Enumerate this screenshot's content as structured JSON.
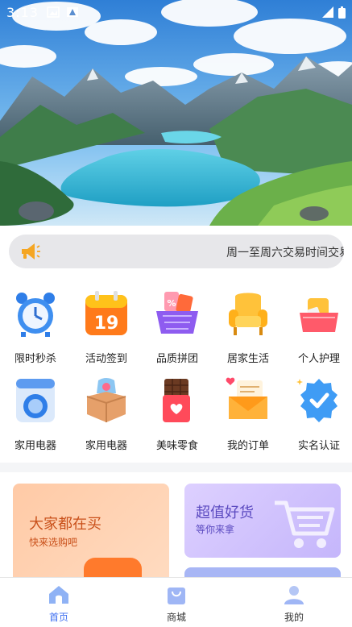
{
  "status_bar": {
    "time": "3:13"
  },
  "notice": {
    "text": "周一至周六交易时间交易"
  },
  "grid": {
    "items": [
      {
        "label": "限时秒杀",
        "icon": "alarm-clock-icon"
      },
      {
        "label": "活动签到",
        "icon": "calendar-19-icon"
      },
      {
        "label": "品质拼团",
        "icon": "shopping-basket-icon"
      },
      {
        "label": "居家生活",
        "icon": "armchair-icon"
      },
      {
        "label": "个人护理",
        "icon": "gift-basket-icon"
      },
      {
        "label": "家用电器",
        "icon": "washing-machine-icon"
      },
      {
        "label": "家用电器",
        "icon": "open-box-icon"
      },
      {
        "label": "美味零食",
        "icon": "chocolate-icon"
      },
      {
        "label": "我的订单",
        "icon": "order-envelope-icon"
      },
      {
        "label": "实名认证",
        "icon": "verified-badge-icon"
      }
    ]
  },
  "promo": {
    "left": {
      "title": "大家都在买",
      "subtitle": "快来选购吧"
    },
    "right": {
      "title": "超值好货",
      "subtitle": "等你来拿"
    }
  },
  "tabbar": {
    "tabs": [
      {
        "label": "首页",
        "active": true,
        "icon": "home-icon"
      },
      {
        "label": "商城",
        "active": false,
        "icon": "shopping-bag-icon"
      },
      {
        "label": "我的",
        "active": false,
        "icon": "profile-icon"
      }
    ],
    "active_color": "#3f6ff0"
  }
}
